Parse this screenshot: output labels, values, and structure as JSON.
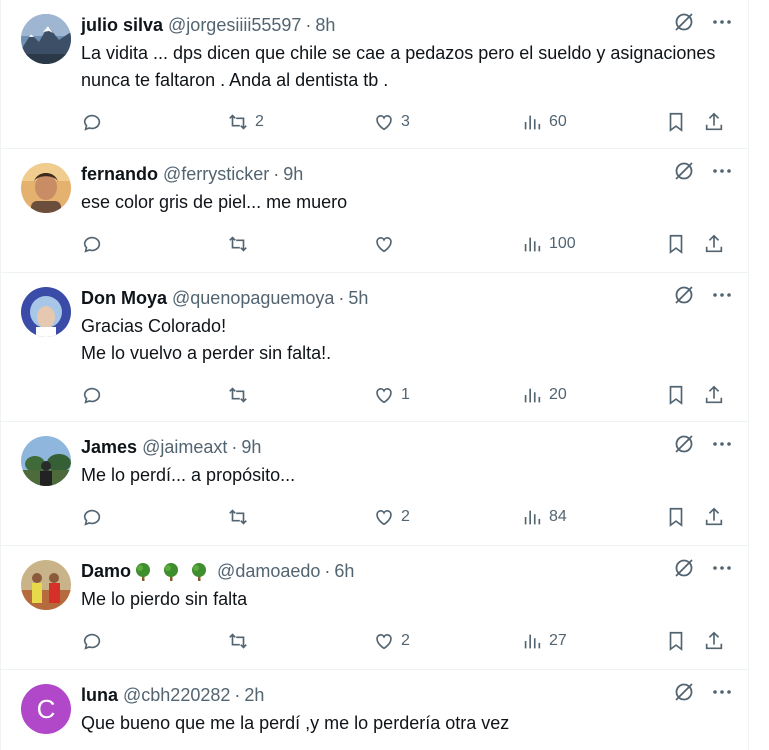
{
  "tweets": [
    {
      "name": "julio silva",
      "handle": "@jorgesiiii55597",
      "time": "8h",
      "text": "La vidita ... dps dicen que chile se cae a pedazos pero el sueldo y asignaciones nunca te faltaron . Anda al dentista tb .",
      "retweets": "2",
      "likes": "3",
      "views": "60"
    },
    {
      "name": "fernando",
      "handle": "@ferrysticker",
      "time": "9h",
      "text": "ese color gris de piel... me muero",
      "retweets": "",
      "likes": "",
      "views": "100"
    },
    {
      "name": "Don Moya",
      "handle": "@quenopaguemoya",
      "time": "5h",
      "text": "Gracias Colorado!\nMe lo vuelvo a perder sin falta!.",
      "retweets": "",
      "likes": "1",
      "views": "20"
    },
    {
      "name": "James",
      "handle": "@jaimeaxt",
      "time": "9h",
      "text": "Me lo perdí... a propósito...",
      "retweets": "",
      "likes": "2",
      "views": "84"
    },
    {
      "name": "Damo",
      "name_emoji": "tree-emoji x3",
      "handle": "@damoaedo",
      "time": "6h",
      "text": "Me lo pierdo sin falta",
      "retweets": "",
      "likes": "2",
      "views": "27"
    },
    {
      "name": "luna",
      "avatar_letter": "C",
      "handle": "@cbh220282",
      "time": "2h",
      "text": "Que bueno que me la perdí ,y me lo perdería otra vez",
      "retweets": "",
      "likes": "",
      "views": ""
    }
  ],
  "separator": "·",
  "colors": {
    "text": "#0f1419",
    "muted": "#536471",
    "border": "#eff3f4",
    "luna_avatar": "#b048c9"
  }
}
